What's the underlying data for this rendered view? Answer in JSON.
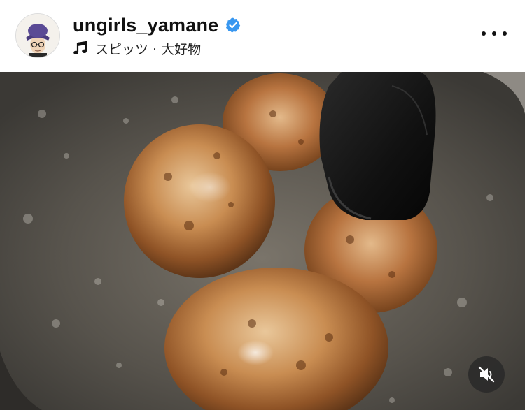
{
  "post": {
    "username": "ungirls_yamane",
    "verified": true,
    "audio": "スピッツ · 大好物"
  },
  "icons": {
    "verified": "verified-badge-icon",
    "music": "music-note-icon",
    "more": "more-options-icon",
    "mute": "muted-speaker-icon"
  },
  "colors": {
    "verified_blue": "#3897f0",
    "text": "#111111"
  }
}
